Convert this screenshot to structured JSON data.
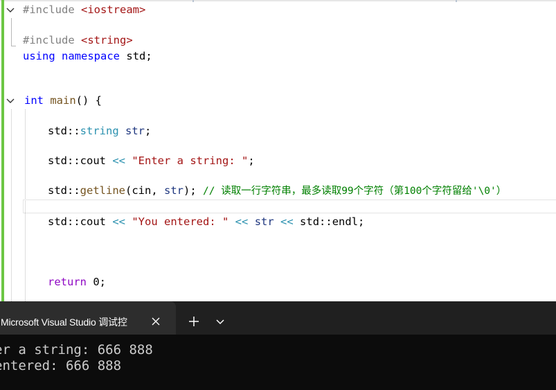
{
  "editor": {
    "lines": {
      "l1_pp": "#include",
      "l1_hdr": "<iostream>",
      "l2_pp": "#include",
      "l2_hdr": "<string>",
      "l3_kw1": "using",
      "l3_kw2": "namespace",
      "l3_rest": "std;",
      "l4_kw": "int",
      "l4_fn": "main",
      "l4_rest": "() {",
      "l5_ns": "std::",
      "l5_typ": "string",
      "l5_var": "str",
      "l5_end": ";",
      "l6_ns": "std::cout ",
      "l6_op": "<<",
      "l6_str": "\"Enter a string: \"",
      "l6_end": ";",
      "l7_ns": "std::",
      "l7_fn": "getline",
      "l7_args": "(cin, ",
      "l7_var": "str",
      "l7_end": "); ",
      "l7_cmt": "// 读取一行字符串，最多读取99个字符（第100个字符留给'\\0'）",
      "l8_ns": "std::cout ",
      "l8_op1": "<<",
      "l8_str": "\"You entered: \"",
      "l8_op2": "<<",
      "l8_var": "str",
      "l8_op3": "<<",
      "l8_end": "std::endl;",
      "l9_kw": "return",
      "l9_rest": " 0;"
    }
  },
  "terminal": {
    "tab_title": "Microsoft Visual Studio 调试控",
    "output": [
      "er a string: 666 888",
      "entered: 666 888"
    ]
  },
  "icons": {
    "fold": "chevron-down-icon",
    "close": "close-icon",
    "new_tab": "plus-icon",
    "dropdown": "chevron-down-icon"
  },
  "colors": {
    "keyword": "#0000ff",
    "control_keyword": "#8f08c4",
    "type": "#2b91af",
    "string": "#a31515",
    "comment": "#008000",
    "preprocessor": "#808080",
    "change_bar": "#6cc644",
    "terminal_bg": "#0c0c0c"
  }
}
